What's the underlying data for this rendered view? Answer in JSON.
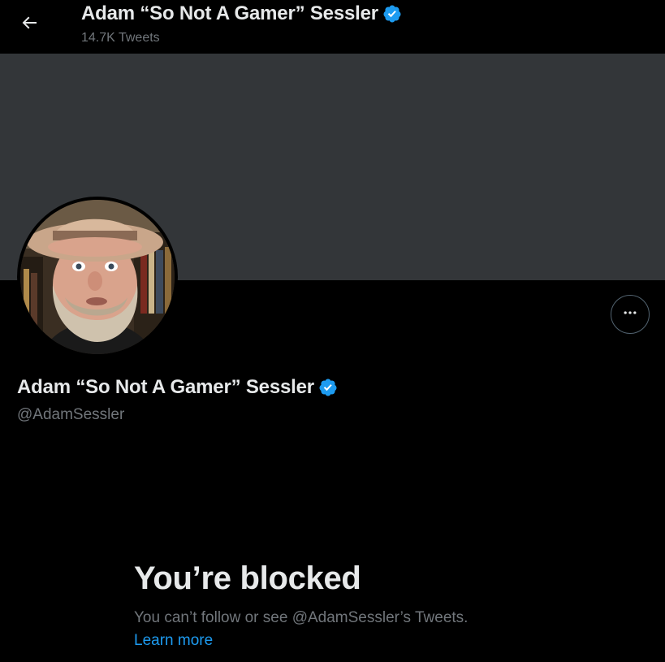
{
  "header": {
    "title": "Adam “So Not A Gamer” Sessler",
    "tweet_count": "14.7K Tweets",
    "back_icon": "arrow-left-icon"
  },
  "profile": {
    "name": "Adam “So Not A Gamer” Sessler",
    "handle": "@AdamSessler",
    "verified": true,
    "verified_icon": "verified-badge-icon",
    "more_icon": "more-horizontal-icon"
  },
  "blocked_notice": {
    "title": "You’re blocked",
    "description": "You can’t follow or see @AdamSessler’s Tweets.",
    "link_label": "Learn more"
  },
  "colors": {
    "background": "#000000",
    "banner": "#333639",
    "primary_text": "#e7e9ea",
    "secondary_text": "#71767b",
    "accent": "#1d9bf0"
  }
}
